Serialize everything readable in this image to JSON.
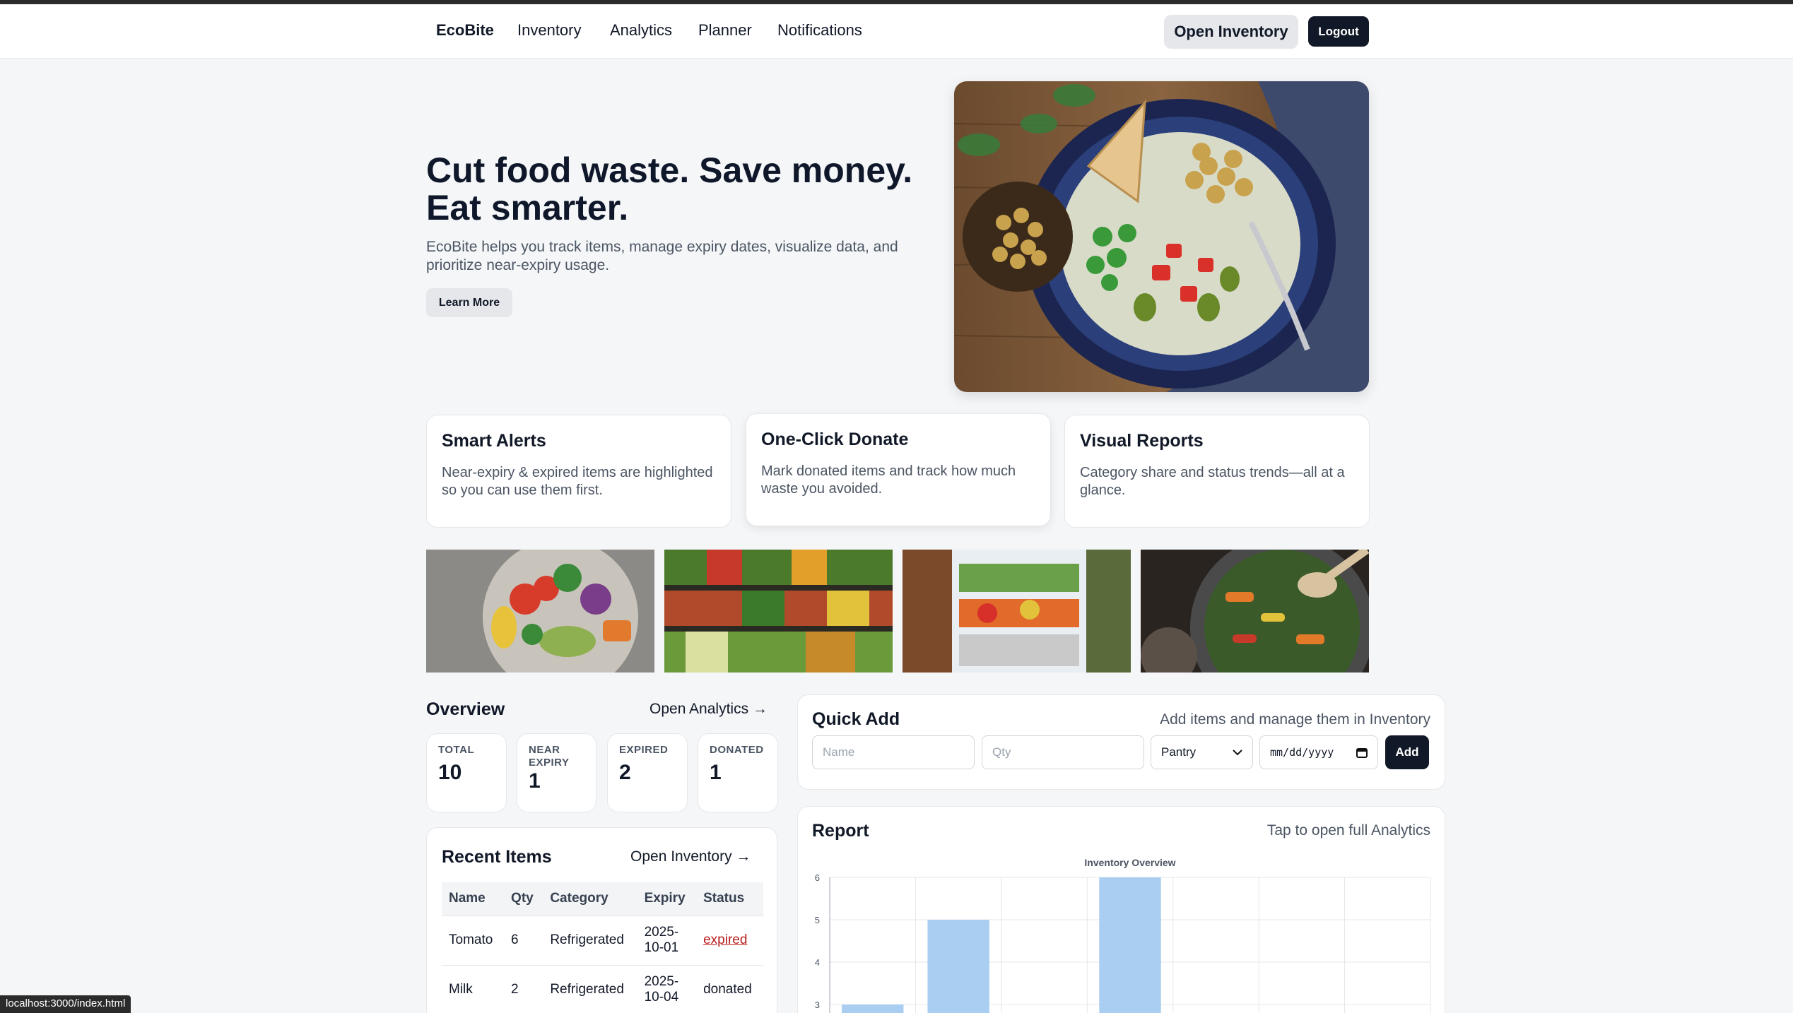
{
  "nav": {
    "brand": "EcoBite",
    "links": [
      "Inventory",
      "Analytics",
      "Planner",
      "Notifications"
    ],
    "open_inventory": "Open Inventory",
    "logout": "Logout"
  },
  "hero": {
    "title_line1": "Cut food waste. Save money.",
    "title_line2": "Eat smarter.",
    "subtitle": "EcoBite helps you track items, manage expiry dates, visualize data, and prioritize near-expiry usage.",
    "learn_more": "Learn More"
  },
  "features": [
    {
      "title": "Smart Alerts",
      "text": "Near-expiry & expired items are highlighted so you can use them first."
    },
    {
      "title": "One-Click Donate",
      "text": "Mark donated items and track how much waste you avoided."
    },
    {
      "title": "Visual Reports",
      "text": "Category share and status trends—all at a glance."
    }
  ],
  "overview": {
    "title": "Overview",
    "link": "Open Analytics →",
    "stats": [
      {
        "label": "TOTAL",
        "value": "10"
      },
      {
        "label": "NEAR EXPIRY",
        "value": "1"
      },
      {
        "label": "EXPIRED",
        "value": "2"
      },
      {
        "label": "DONATED",
        "value": "1"
      }
    ]
  },
  "recent": {
    "title": "Recent Items",
    "link": "Open Inventory →",
    "columns": [
      "Name",
      "Qty",
      "Category",
      "Expiry",
      "Status"
    ],
    "rows": [
      {
        "name": "Tomato",
        "qty": "6",
        "category": "Refrigerated",
        "expiry_1": "2025-",
        "expiry_2": "10-01",
        "status": "expired"
      },
      {
        "name": "Milk",
        "qty": "2",
        "category": "Refrigerated",
        "expiry_1": "2025-",
        "expiry_2": "10-04",
        "status": "donated"
      }
    ]
  },
  "quick_add": {
    "title": "Quick Add",
    "hint": "Add items and manage them in Inventory",
    "name_placeholder": "Name",
    "qty_placeholder": "Qty",
    "category_selected": "Pantry",
    "date_placeholder": "mm/dd/yyyy",
    "add": "Add"
  },
  "report": {
    "title": "Report",
    "hint": "Tap to open full Analytics"
  },
  "chart_data": {
    "type": "bar",
    "title": "Inventory Overview",
    "y_ticks": [
      "6",
      "5",
      "4",
      "3"
    ],
    "values": [
      3,
      5,
      null,
      6,
      null,
      null,
      null
    ],
    "ylim": [
      2.4,
      6
    ],
    "grid": true,
    "bar_color": "#a9cef1"
  },
  "status_url": "localhost:3000/index.html"
}
